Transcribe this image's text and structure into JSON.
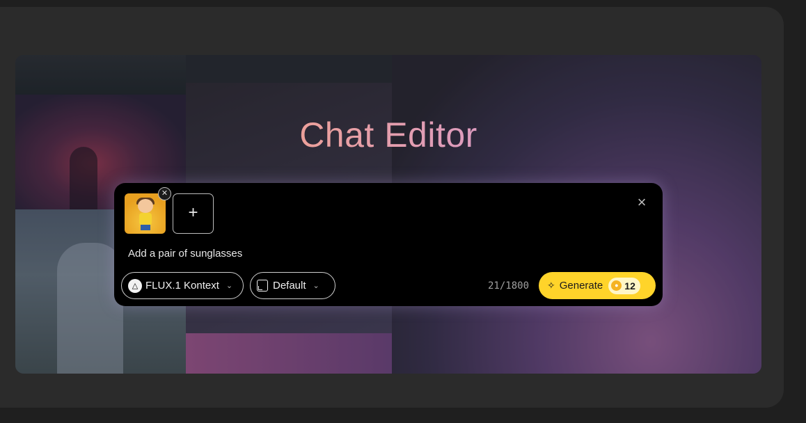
{
  "hero": {
    "title": "Chat Editor"
  },
  "editor": {
    "prompt_text": "Add a pair of sunglasses",
    "thumbnail_icon": "image-thumbnail",
    "remove_icon": "close-icon",
    "add_label": "+",
    "close_icon": "close-icon",
    "model": {
      "label": "FLUX.1 Kontext",
      "icon": "flux-logo-icon"
    },
    "aspect": {
      "label": "Default",
      "icon": "aspect-ratio-icon"
    },
    "char_count": "21/1800",
    "generate": {
      "label": "Generate",
      "icon": "sparkle-icon",
      "cost": "12",
      "cost_icon": "coin-icon"
    }
  },
  "colors": {
    "accent": "#ffd42a",
    "panel_bg": "#000000",
    "page_bg": "#2b2b2b"
  }
}
